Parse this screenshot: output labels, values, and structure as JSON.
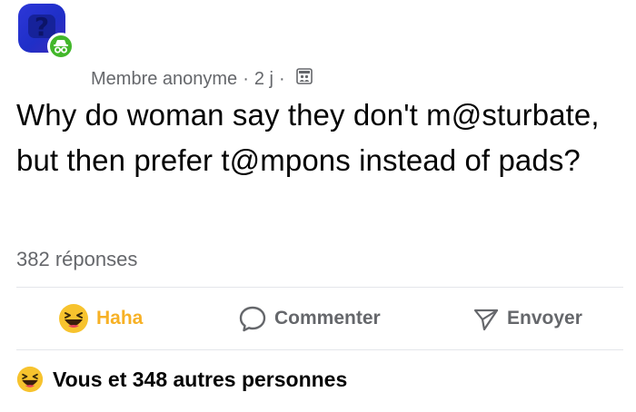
{
  "post": {
    "author": "Membre anonyme",
    "separator": "·",
    "time": "2 j",
    "text": "Why do woman say they don't m@sturbate, but then prefer t@mpons instead of pads?",
    "replies": "382 réponses"
  },
  "actions": {
    "haha": "Haha",
    "comment": "Commenter",
    "send": "Envoyer"
  },
  "reactions": {
    "summary": "Vous et 348 autres personnes"
  },
  "colors": {
    "avatar_blue": "#2d37d8",
    "anonymous_green": "#42b72a",
    "haha_yellow": "#f7b125",
    "secondary_text": "#65676b"
  },
  "icons": {
    "avatar": "group-question-icon",
    "anonymous_badge": "incognito-icon",
    "audience": "group-members-icon",
    "haha": "laughing-emoji-icon",
    "comment": "speech-bubble-icon",
    "send": "paper-plane-icon"
  }
}
